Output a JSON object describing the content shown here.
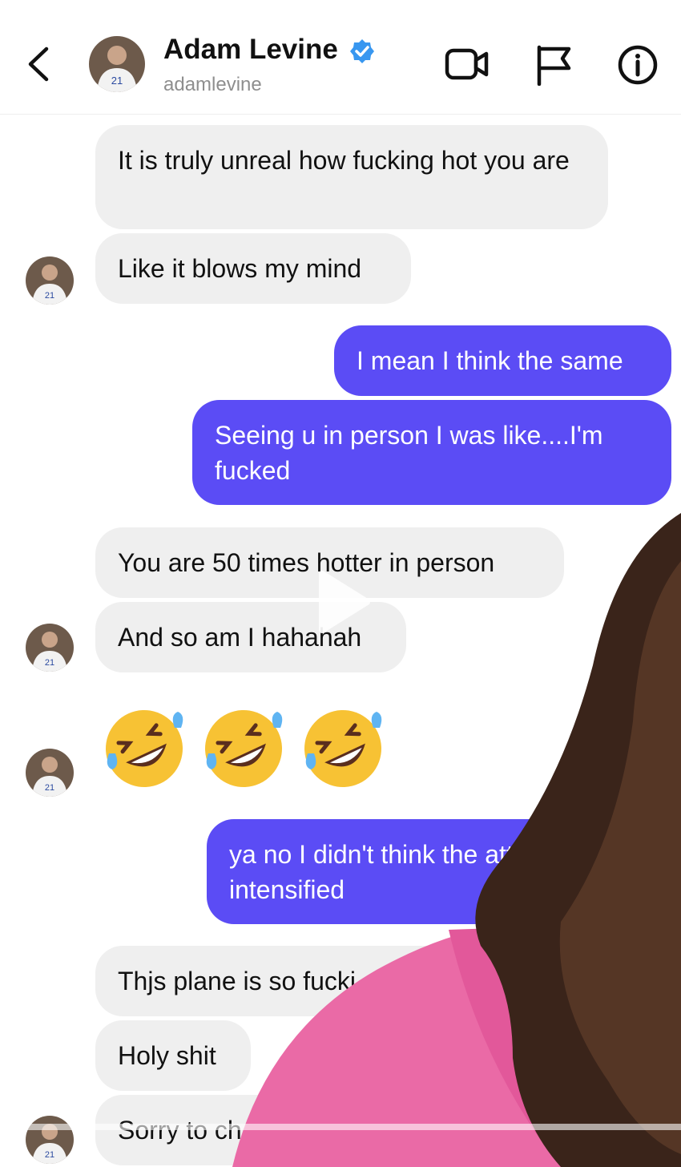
{
  "header": {
    "name": "Adam Levine",
    "handle": "adamlevine"
  },
  "messages": [
    {
      "side": "in",
      "text": "It is truly unreal how fucking hot you are"
    },
    {
      "side": "in",
      "text": "Like it blows my mind"
    },
    {
      "side": "out",
      "text": "I mean I think the same"
    },
    {
      "side": "out",
      "text": "Seeing u in person I was like....I'm fucked"
    },
    {
      "side": "in",
      "text": "You are 50 times hotter in person"
    },
    {
      "side": "in",
      "text": "And so am I hahahah"
    },
    {
      "side": "out",
      "text": "ya no I didn't think the att could be intensified"
    },
    {
      "side": "in",
      "text": "Thjs plane is so fucki"
    },
    {
      "side": "in",
      "text": "Holy shit"
    },
    {
      "side": "in",
      "text": "Sorry to ch"
    }
  ],
  "emoji_reactions": [
    "rolling-on-floor-laughing",
    "rolling-on-floor-laughing",
    "rolling-on-floor-laughing"
  ],
  "colors": {
    "outgoing_bubble": "#5b4cf5",
    "incoming_bubble": "#efefef",
    "verified_badge": "#3897f0"
  }
}
